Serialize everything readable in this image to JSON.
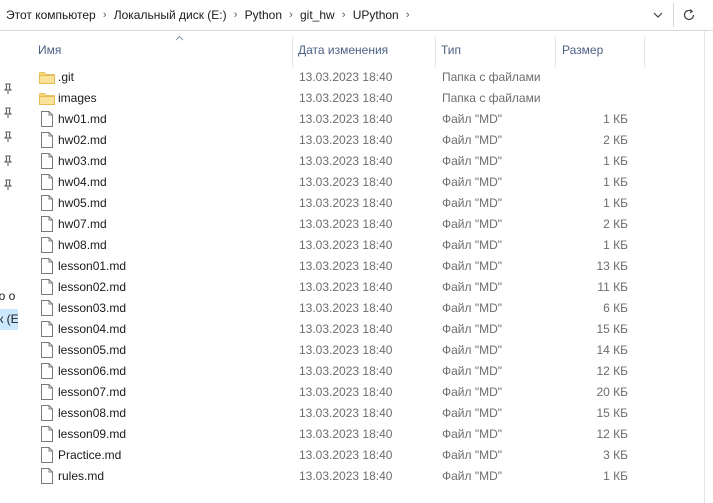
{
  "breadcrumbs": [
    "Этот компьютер",
    "Локальный диск (E:)",
    "Python",
    "git_hw",
    "UPython"
  ],
  "columns": {
    "name": "Имя",
    "date": "Дата изменения",
    "type": "Тип",
    "size": "Размер"
  },
  "nav_pane": {
    "partial_item_1": "но о",
    "partial_item_2": "ск (E"
  },
  "files": [
    {
      "name": ".git",
      "date": "13.03.2023 18:40",
      "type": "Папка с файлами",
      "size": "",
      "kind": "folder"
    },
    {
      "name": "images",
      "date": "13.03.2023 18:40",
      "type": "Папка с файлами",
      "size": "",
      "kind": "folder"
    },
    {
      "name": "hw01.md",
      "date": "13.03.2023 18:40",
      "type": "Файл \"MD\"",
      "size": "1 КБ",
      "kind": "file"
    },
    {
      "name": "hw02.md",
      "date": "13.03.2023 18:40",
      "type": "Файл \"MD\"",
      "size": "2 КБ",
      "kind": "file"
    },
    {
      "name": "hw03.md",
      "date": "13.03.2023 18:40",
      "type": "Файл \"MD\"",
      "size": "1 КБ",
      "kind": "file"
    },
    {
      "name": "hw04.md",
      "date": "13.03.2023 18:40",
      "type": "Файл \"MD\"",
      "size": "1 КБ",
      "kind": "file"
    },
    {
      "name": "hw05.md",
      "date": "13.03.2023 18:40",
      "type": "Файл \"MD\"",
      "size": "1 КБ",
      "kind": "file"
    },
    {
      "name": "hw07.md",
      "date": "13.03.2023 18:40",
      "type": "Файл \"MD\"",
      "size": "2 КБ",
      "kind": "file"
    },
    {
      "name": "hw08.md",
      "date": "13.03.2023 18:40",
      "type": "Файл \"MD\"",
      "size": "1 КБ",
      "kind": "file"
    },
    {
      "name": "lesson01.md",
      "date": "13.03.2023 18:40",
      "type": "Файл \"MD\"",
      "size": "13 КБ",
      "kind": "file"
    },
    {
      "name": "lesson02.md",
      "date": "13.03.2023 18:40",
      "type": "Файл \"MD\"",
      "size": "11 КБ",
      "kind": "file"
    },
    {
      "name": "lesson03.md",
      "date": "13.03.2023 18:40",
      "type": "Файл \"MD\"",
      "size": "6 КБ",
      "kind": "file"
    },
    {
      "name": "lesson04.md",
      "date": "13.03.2023 18:40",
      "type": "Файл \"MD\"",
      "size": "15 КБ",
      "kind": "file"
    },
    {
      "name": "lesson05.md",
      "date": "13.03.2023 18:40",
      "type": "Файл \"MD\"",
      "size": "14 КБ",
      "kind": "file"
    },
    {
      "name": "lesson06.md",
      "date": "13.03.2023 18:40",
      "type": "Файл \"MD\"",
      "size": "12 КБ",
      "kind": "file"
    },
    {
      "name": "lesson07.md",
      "date": "13.03.2023 18:40",
      "type": "Файл \"MD\"",
      "size": "20 КБ",
      "kind": "file"
    },
    {
      "name": "lesson08.md",
      "date": "13.03.2023 18:40",
      "type": "Файл \"MD\"",
      "size": "15 КБ",
      "kind": "file"
    },
    {
      "name": "lesson09.md",
      "date": "13.03.2023 18:40",
      "type": "Файл \"MD\"",
      "size": "12 КБ",
      "kind": "file"
    },
    {
      "name": "Practice.md",
      "date": "13.03.2023 18:40",
      "type": "Файл \"MD\"",
      "size": "3 КБ",
      "kind": "file"
    },
    {
      "name": "rules.md",
      "date": "13.03.2023 18:40",
      "type": "Файл \"MD\"",
      "size": "1 КБ",
      "kind": "file"
    }
  ],
  "icons": {
    "folder": "folder-icon",
    "file": "file-icon",
    "pin": "pin-icon",
    "dropdown": "chevron-down-icon",
    "refresh": "refresh-icon",
    "sort": "sort-up-icon"
  },
  "colors": {
    "header_text": "#4d6185",
    "secondary_text": "#6d6d6d",
    "folder": "#f8d775",
    "nav_selection": "#cce8ff"
  }
}
